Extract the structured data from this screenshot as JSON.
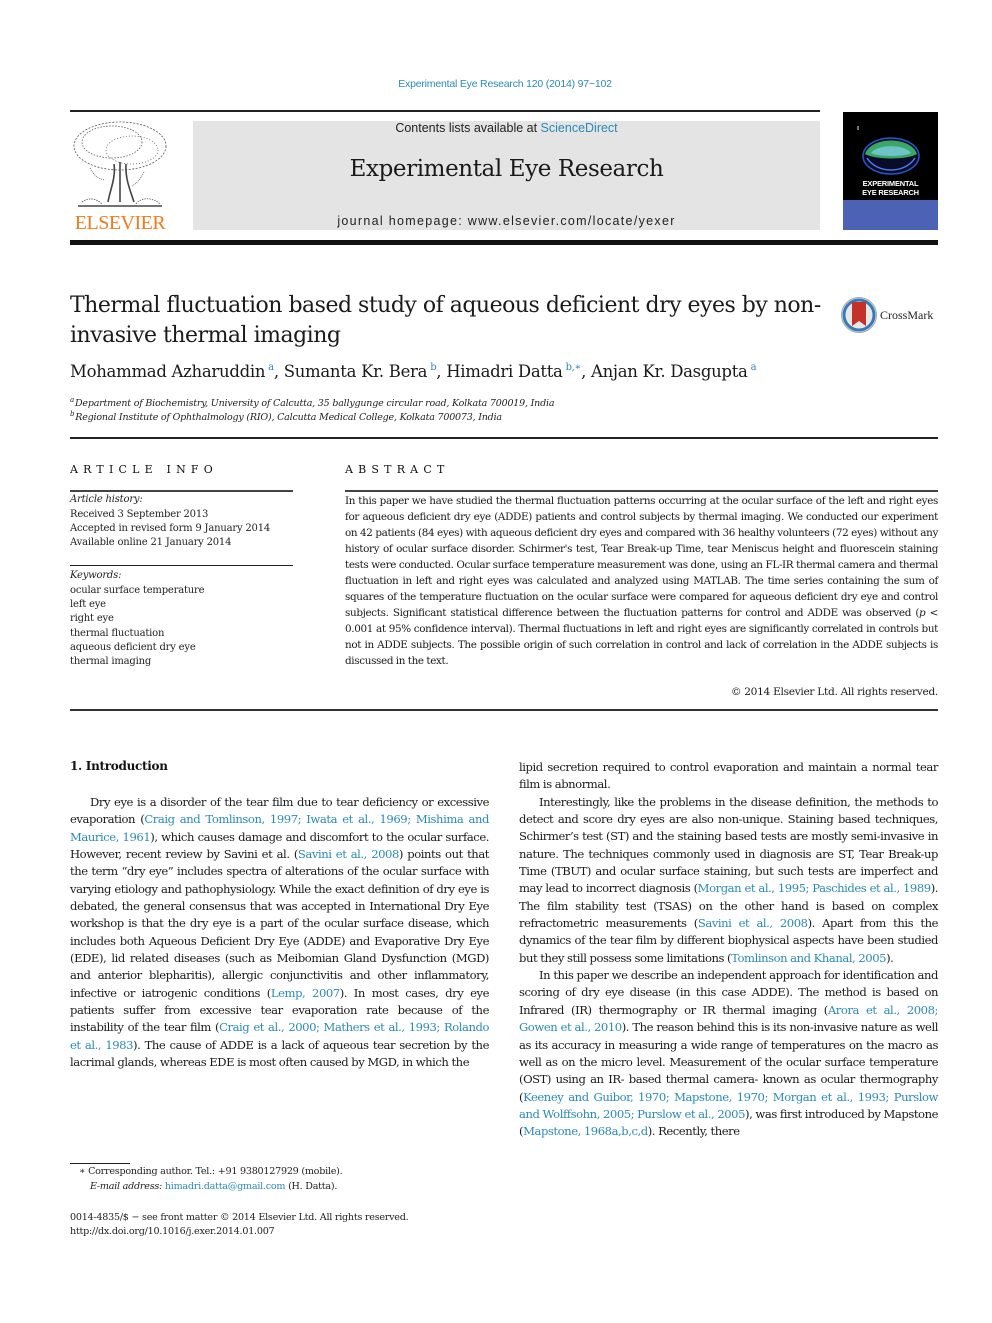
{
  "header": {
    "journal_ref": "Experimental Eye Research 120 (2014) 97−102",
    "contents_prefix": "Contents lists available at ",
    "contents_link": "ScienceDirect",
    "journal_name": "Experimental Eye Research",
    "homepage_prefix": "journal homepage: ",
    "homepage_url": "www.elsevier.com/locate/yexer",
    "publisher_logo": "ELSEVIER",
    "cover_title_line1": "EXPERIMENTAL",
    "cover_title_line2": "EYE RESEARCH"
  },
  "article": {
    "title": "Thermal fluctuation based study of aqueous deficient dry eyes by non-invasive thermal imaging",
    "crossmark_label": "CrossMark",
    "authors": [
      {
        "name": "Mohammad Azharuddin",
        "sup": "a"
      },
      {
        "name": "Sumanta Kr. Bera",
        "sup": "b"
      },
      {
        "name": "Himadri Datta",
        "sup": "b,∗"
      },
      {
        "name": "Anjan Kr. Dasgupta",
        "sup": "a"
      }
    ],
    "affiliations": [
      {
        "sup": "a",
        "text": "Department of Biochemistry, University of Calcutta, 35 ballygunge circular road, Kolkata 700019, India"
      },
      {
        "sup": "b",
        "text": "Regional Institute of Ophthalmology (RIO), Calcutta Medical College, Kolkata 700073, India"
      }
    ]
  },
  "article_info": {
    "heading": "ARTICLE INFO",
    "history_label": "Article history:",
    "history": [
      "Received 3 September 2013",
      "Accepted in revised form 9 January 2014",
      "Available online 21 January 2014"
    ],
    "keywords_label": "Keywords:",
    "keywords": [
      "ocular surface temperature",
      "left eye",
      "right eye",
      "thermal fluctuation",
      "aqueous deficient dry eye",
      "thermal imaging"
    ]
  },
  "abstract": {
    "heading": "ABSTRACT",
    "text_part1": "In this paper we have studied the thermal fluctuation patterns occurring at the ocular surface of the left and right eyes for aqueous deficient dry eye (ADDE) patients and control subjects by thermal imaging. We conducted our experiment on 42 patients (84 eyes) with aqueous deficient dry eyes and compared with 36 healthy volunteers (72 eyes) without any history of ocular surface disorder. Schirmer's test, Tear Break-up Time, tear Meniscus height and fluorescein staining tests were conducted. Ocular surface temperature measurement was done, using an FL-IR thermal camera and thermal fluctuation in left and right eyes was calculated and analyzed using MATLAB. The time series containing the sum of squares of the temperature fluctuation on the ocular surface were compared for aqueous deficient dry eye and control subjects. Significant statistical difference between the fluctuation patterns for control and ADDE was observed (",
    "p_symbol": "p",
    "text_part2": " < 0.001 at 95% confidence interval). Thermal fluctuations in left and right eyes are significantly correlated in controls but not in ADDE subjects. The possible origin of such correlation in control and lack of correlation in the ADDE subjects is discussed in the text.",
    "copyright": "© 2014 Elsevier Ltd. All rights reserved."
  },
  "body": {
    "section_heading": "1.  Introduction",
    "left": {
      "p1": [
        {
          "t": "Dry eye is a disorder of the tear film due to tear deficiency or excessive evaporation ("
        },
        {
          "l": "Craig and Tomlinson, 1997; Iwata et al., 1969; Mishima and Maurice, 1961"
        },
        {
          "t": "), which causes damage and discomfort to the ocular surface. However, recent review by Savini et al. ("
        },
        {
          "l": "Savini et al., 2008"
        },
        {
          "t": ") points out that the term “dry eye” includes spectra of alterations of the ocular surface with varying etiology and pathophysiology. While the exact definition of dry eye is debated, the general consensus that was accepted in International Dry Eye workshop is that the dry eye is a part of the ocular surface disease, which includes both Aqueous Deficient Dry Eye (ADDE) and Evaporative Dry Eye (EDE), lid related diseases (such as Meibomian Gland Dysfunction (MGD) and anterior blepharitis), allergic conjunctivitis and other inflammatory, infective or iatrogenic conditions ("
        },
        {
          "l": "Lemp, 2007"
        },
        {
          "t": "). In most cases, dry eye patients suffer from excessive tear evaporation rate because of the instability of the tear film ("
        },
        {
          "l": "Craig et al., 2000; Mathers et al., 1993; Rolando et al., 1983"
        },
        {
          "t": "). The cause of ADDE is a lack of aqueous tear secretion by the lacrimal glands, whereas EDE is most often caused by MGD, in which the"
        }
      ]
    },
    "right": {
      "p0": [
        {
          "t": "lipid secretion required to control evaporation and maintain a normal tear film is abnormal."
        }
      ],
      "p1": [
        {
          "t": "Interestingly, like the problems in the disease definition, the methods to detect and score dry eyes are also non-unique. Staining based techniques, Schirmer’s test (ST) and the staining based tests are mostly semi-invasive in nature. The techniques commonly used in diagnosis are ST, Tear Break-up Time (TBUT) and ocular surface staining, but such tests are imperfect and may lead to incorrect diagnosis ("
        },
        {
          "l": "Morgan et al., 1995; Paschides et al., 1989"
        },
        {
          "t": "). The film stability test (TSAS) on the other hand is based on complex refractometric measurements ("
        },
        {
          "l": "Savini et al., 2008"
        },
        {
          "t": "). Apart from this the dynamics of the tear film by different biophysical aspects have been studied but they still possess some limitations ("
        },
        {
          "l": "Tomlinson and Khanal, 2005"
        },
        {
          "t": ")."
        }
      ],
      "p2": [
        {
          "t": "In this paper we describe an independent approach for identification and scoring of dry eye disease (in this case ADDE). The method is based on Infrared (IR) thermography or IR thermal imaging ("
        },
        {
          "l": "Arora et al., 2008; Gowen et al., 2010"
        },
        {
          "t": "). The reason behind this is its non-invasive nature as well as its accuracy in measuring a wide range of temperatures on the macro as well as on the micro level. Measurement of the ocular surface temperature (OST) using an IR- based thermal camera- known as ocular thermography ("
        },
        {
          "l": "Keeney and Guibor, 1970; Mapstone, 1970; Morgan et al., 1993; Purslow and Wolffsohn, 2005; Purslow et al., 2005"
        },
        {
          "t": "), was first introduced by Mapstone ("
        },
        {
          "l": "Mapstone, 1968a,b,c,d"
        },
        {
          "t": "). Recently, there"
        }
      ]
    }
  },
  "footnotes": {
    "corresponding": "∗  Corresponding author. Tel.: +91 9380127929 (mobile).",
    "email_label": "E-mail address: ",
    "email": "himadri.datta@gmail.com",
    "email_suffix": " (H. Datta).",
    "issn": "0014-4835/$ − see front matter © 2014 Elsevier Ltd. All rights reserved.",
    "doi": "http://dx.doi.org/10.1016/j.exer.2014.01.007"
  },
  "colors": {
    "link": "#2a8ab6",
    "elsevier_orange": "#f07b1c",
    "header_band": "#e4e4e4",
    "cover_blue": "#4c62b4"
  }
}
